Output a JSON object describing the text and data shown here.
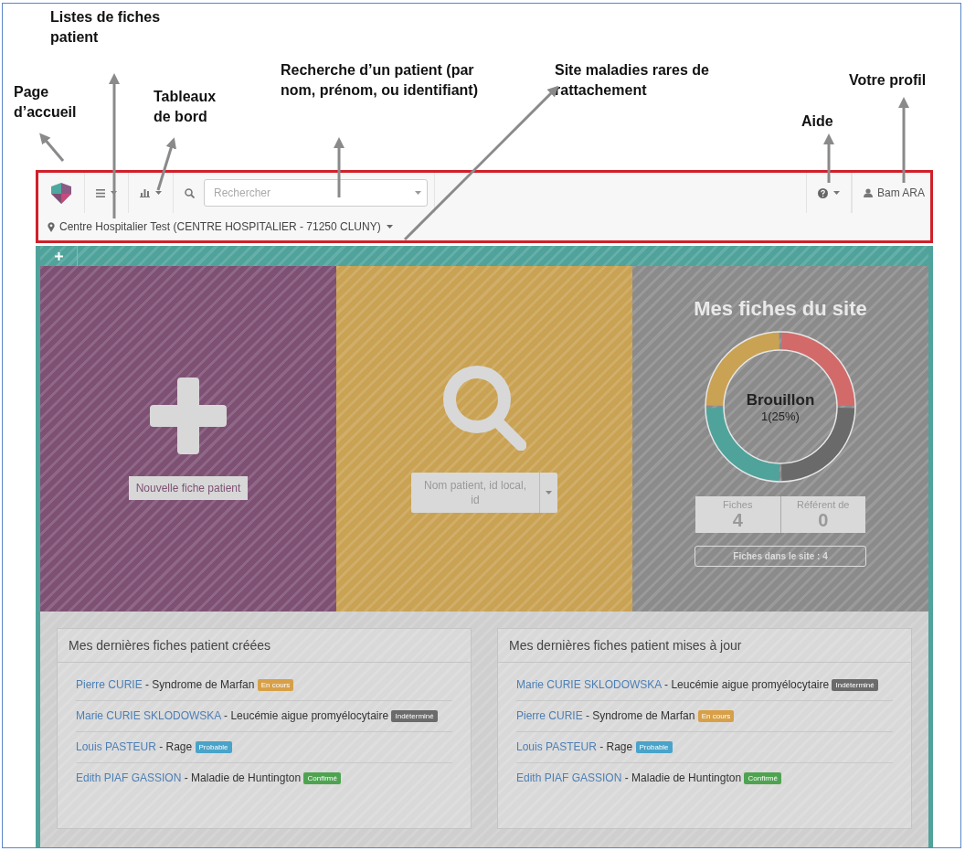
{
  "annotations": [
    {
      "text": "Listes de fiches patient"
    },
    {
      "text": "Page d’accueil"
    },
    {
      "text": "Tableaux de bord"
    },
    {
      "text": "Recherche d’un patient (par nom, prénom, ou identifiant)"
    },
    {
      "text": "Site maladies rares de rattachement"
    },
    {
      "text": "Votre profil"
    },
    {
      "text": "Aide"
    }
  ],
  "navbar": {
    "search": {
      "placeholder": "Rechercher"
    },
    "user": "Bam ARA",
    "site": "Centre Hospitalier Test (CENTRE HOSPITALIER - 71250 CLUNY)"
  },
  "tiles": {
    "new_button": "Nouvelle fiche patient",
    "patient_select": {
      "placeholder": "Nom patient, id local, id"
    },
    "stats": {
      "title": "Mes fiches du site",
      "donut_label": "Brouillon",
      "donut_value": "1(25%)",
      "cells": [
        {
          "label": "Fiches",
          "value": "4"
        },
        {
          "label": "Référent de",
          "value": "0"
        }
      ],
      "site_button": "Fiches dans le site : 4"
    }
  },
  "panels": [
    {
      "title": "Mes dernières fiches patient créées",
      "items": [
        {
          "name": "Pierre CURIE",
          "detail": "- Syndrome de Marfan",
          "status": "En cours",
          "color": "#d7a048"
        },
        {
          "name": "Marie CURIE SKLODOWSKA",
          "detail": "- Leucémie aigue promyélocytaire",
          "status": "Indéterminé",
          "color": "#6b6b6b"
        },
        {
          "name": "Louis PASTEUR",
          "detail": "- Rage",
          "status": "Probable",
          "color": "#4aa3c8"
        },
        {
          "name": "Edith PIAF GASSION",
          "detail": "- Maladie de Huntington",
          "status": "Confirmé",
          "color": "#4ea350"
        }
      ]
    },
    {
      "title": "Mes dernières fiches patient mises à jour",
      "items": [
        {
          "name": "Marie CURIE SKLODOWSKA",
          "detail": "- Leucémie aigue promyélocytaire",
          "status": "Indéterminé",
          "color": "#6b6b6b"
        },
        {
          "name": "Pierre CURIE",
          "detail": "- Syndrome de Marfan",
          "status": "En cours",
          "color": "#d7a048"
        },
        {
          "name": "Louis PASTEUR",
          "detail": "- Rage",
          "status": "Probable",
          "color": "#4aa3c8"
        },
        {
          "name": "Edith PIAF GASSION",
          "detail": "- Maladie de Huntington",
          "status": "Confirmé",
          "color": "#4ea350"
        }
      ]
    }
  ]
}
